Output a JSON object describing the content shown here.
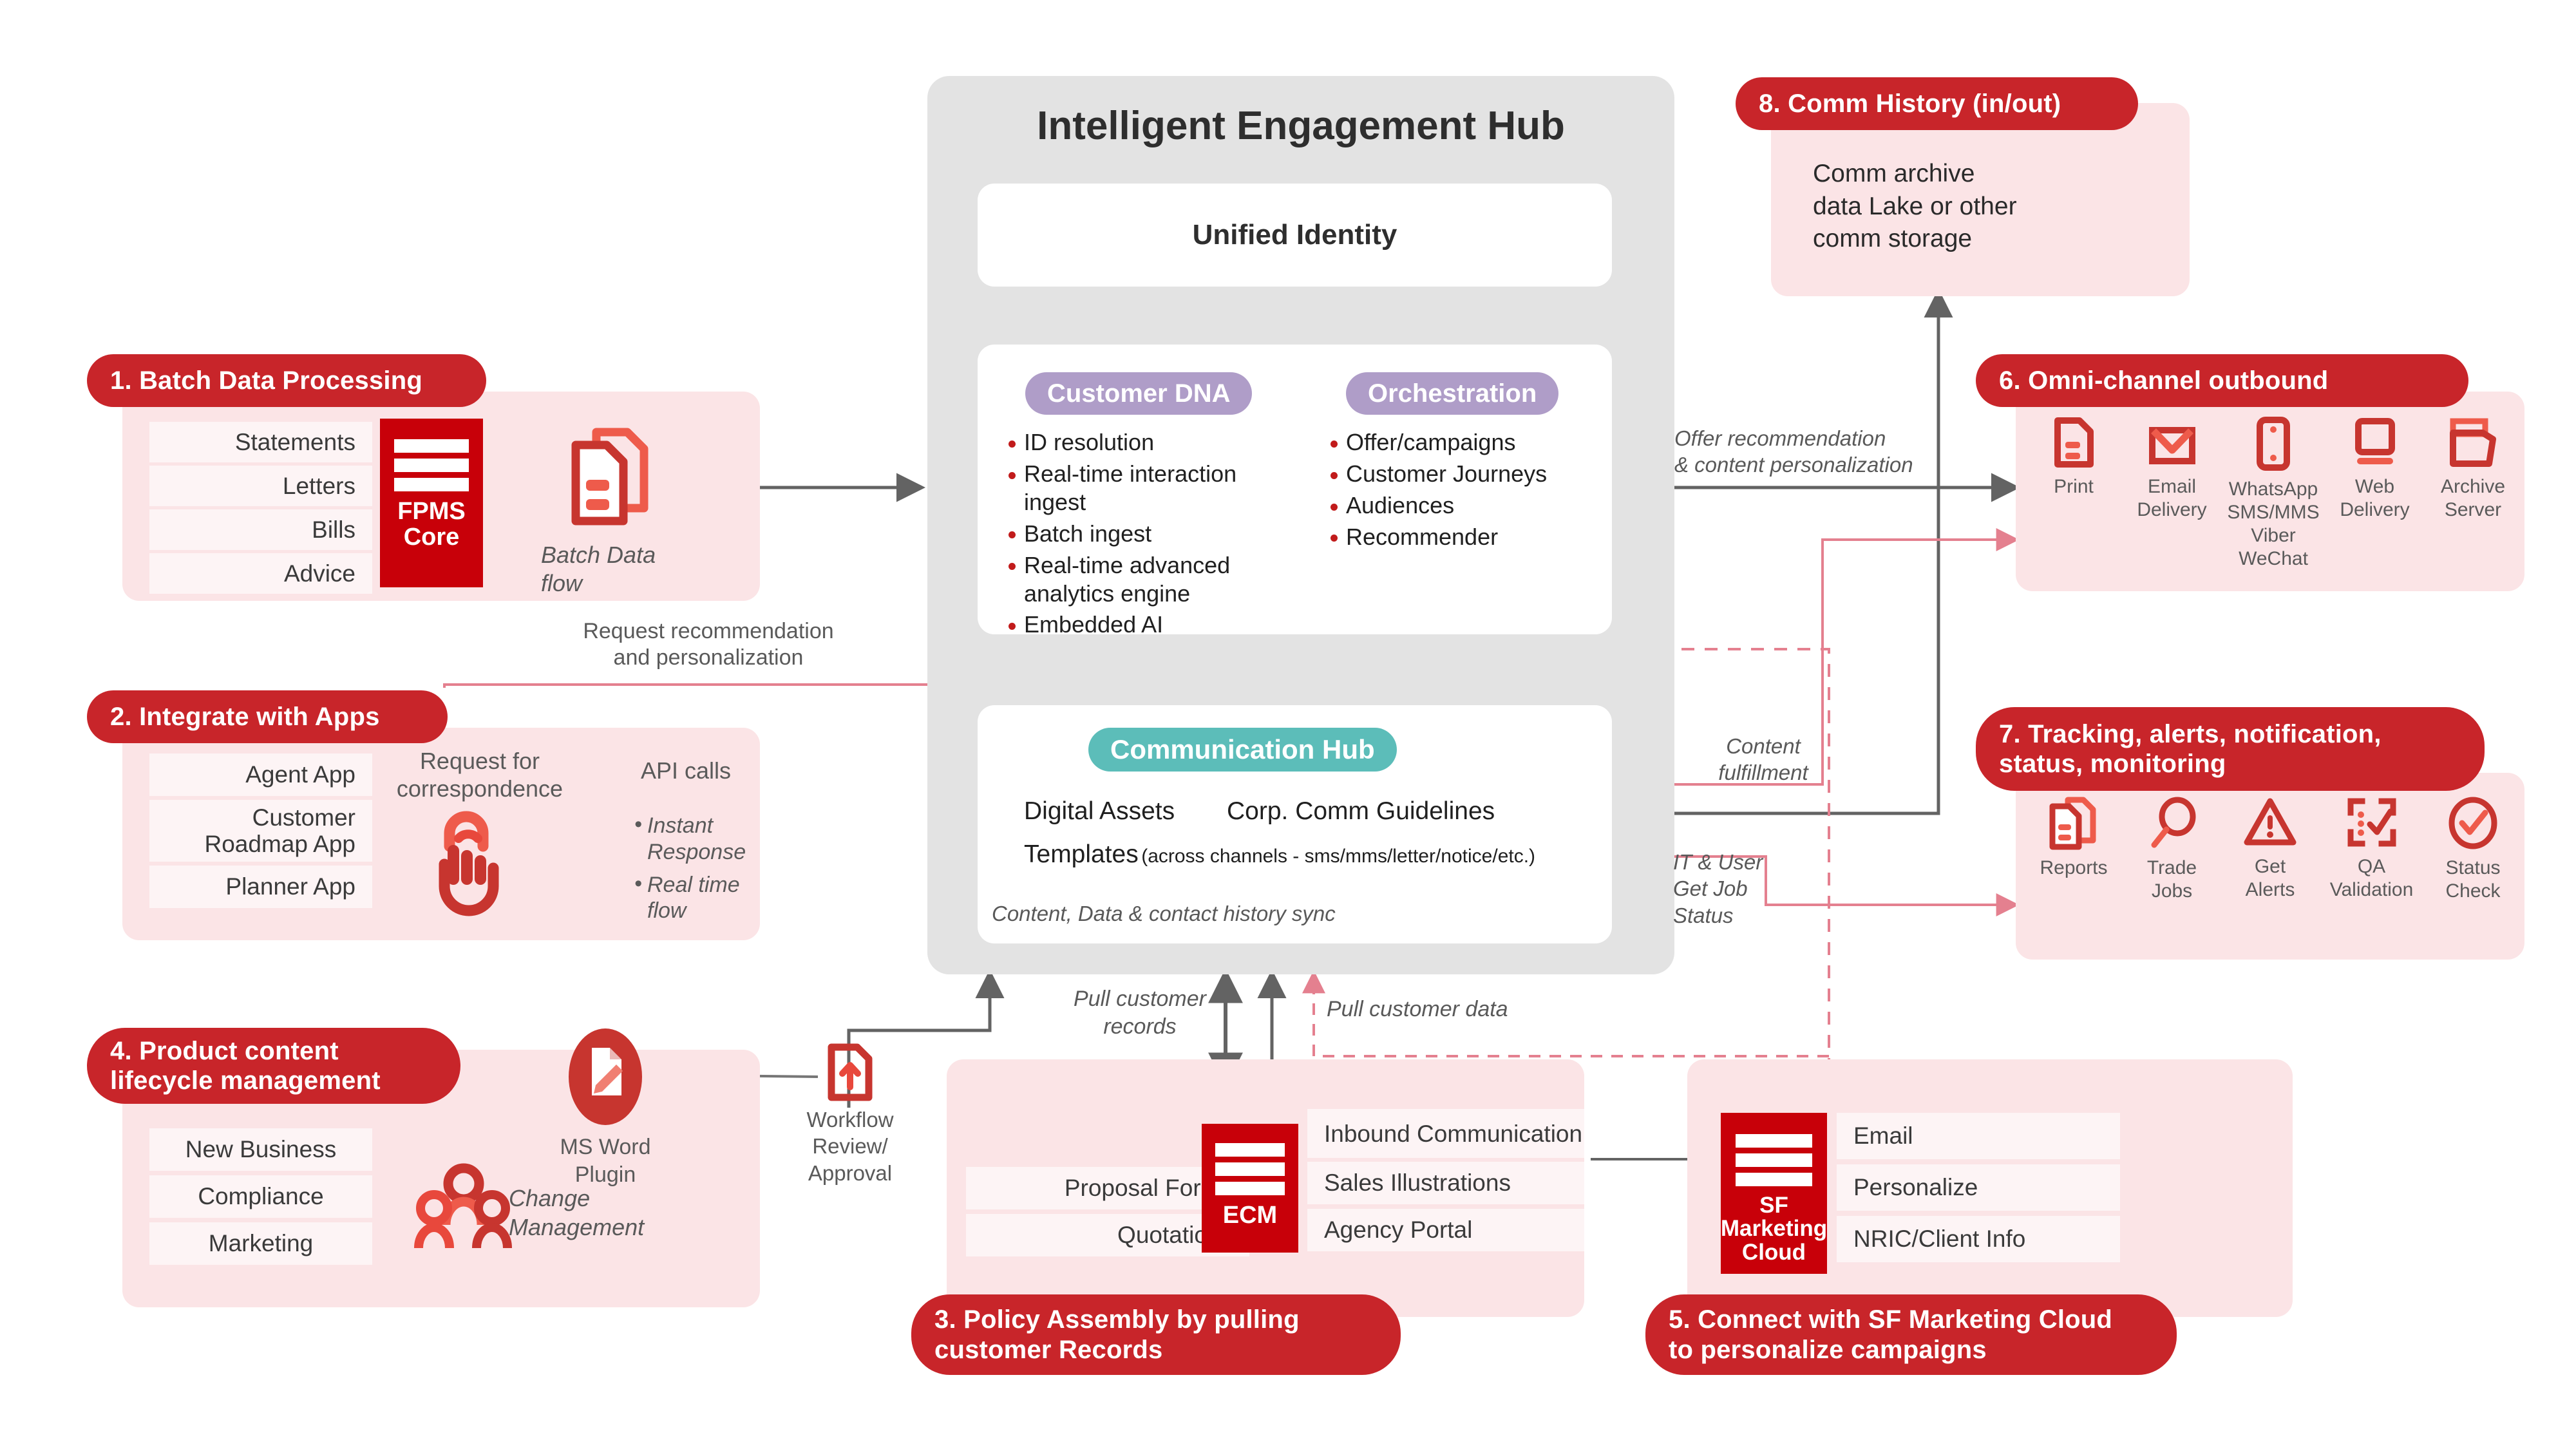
{
  "hub": {
    "title": "Intelligent Engagement Hub",
    "unified_identity": "Unified Identity",
    "customer_dna": {
      "label": "Customer DNA",
      "items": [
        "ID resolution",
        "Real-time interaction ingest",
        "Batch ingest",
        "Real-time advanced analytics engine",
        "Embedded AI"
      ]
    },
    "orchestration": {
      "label": "Orchestration",
      "items": [
        "Offer/campaigns",
        "Customer Journeys",
        "Audiences",
        "Recommender"
      ]
    },
    "communication_hub": {
      "label": "Communication Hub",
      "digital_assets": "Digital Assets",
      "corp_guidelines": "Corp. Comm Guidelines",
      "templates_label": "Templates",
      "templates_note": "(across channels - sms/mms/letter/notice/etc.)",
      "footer": "Content, Data & contact history sync"
    }
  },
  "section1": {
    "badge": "1. Batch Data Processing",
    "rows": [
      "Statements",
      "Letters",
      "Bills",
      "Advice"
    ],
    "core": "FPMS Core",
    "core_line1": "FPMS",
    "core_line2": "Core",
    "icon_caption": "Batch Data flow",
    "icon_caption_l1": "Batch Data",
    "icon_caption_l2": "flow"
  },
  "section2": {
    "badge": "2. Integrate with Apps",
    "rows": [
      "Agent App",
      "Customer Roadmap App",
      "Planner App"
    ],
    "request_label_l1": "Request for",
    "request_label_l2": "correspondence",
    "api_calls": "API calls",
    "bullets": [
      "Instant Response",
      "Real time flow"
    ]
  },
  "section3": {
    "badge": "3. Policy Assembly by pulling customer Records",
    "badge_l1": "3. Policy Assembly by pulling",
    "badge_l2": "customer Records",
    "left_rows": [
      "Proposal Forms",
      "Quotations"
    ],
    "right_rows": [
      "Inbound Communication",
      "Sales Illustrations",
      "Agency Portal"
    ],
    "core_line1": "ECM"
  },
  "section4": {
    "badge_l1": "4. Product content",
    "badge_l2": "lifecycle management",
    "rows": [
      "New Business",
      "Compliance",
      "Marketing"
    ],
    "ms_word_l1": "MS Word",
    "ms_word_l2": "Plugin",
    "change_l1": "Change",
    "change_l2": "Management"
  },
  "section5": {
    "badge_l1": "5. Connect with SF Marketing Cloud",
    "badge_l2": "to personalize campaigns",
    "core_l1": "SF",
    "core_l2": "Marketing",
    "core_l3": "Cloud",
    "rows": [
      "Email",
      "Personalize",
      "NRIC/Client Info"
    ]
  },
  "section6": {
    "badge": "6. Omni-channel outbound",
    "channels": [
      {
        "icon": "document-icon",
        "l1": "Print",
        "l2": "",
        "l3": "",
        "l4": ""
      },
      {
        "icon": "envelope-icon",
        "l1": "Email",
        "l2": "Delivery",
        "l3": "",
        "l4": ""
      },
      {
        "icon": "mobile-icon",
        "l1": "WhatsApp",
        "l2": "SMS/MMS",
        "l3": "Viber",
        "l4": "WeChat"
      },
      {
        "icon": "monitor-icon",
        "l1": "Web",
        "l2": "Delivery",
        "l3": "",
        "l4": ""
      },
      {
        "icon": "folder-icon",
        "l1": "Archive",
        "l2": "Server",
        "l3": "",
        "l4": ""
      }
    ]
  },
  "section7": {
    "badge_l1": "7. Tracking, alerts, notification,",
    "badge_l2": "status, monitoring",
    "items": [
      {
        "icon": "reports-icon",
        "l1": "Reports",
        "l2": ""
      },
      {
        "icon": "magnifier-icon",
        "l1": "Trade",
        "l2": "Jobs"
      },
      {
        "icon": "warning-icon",
        "l1": "Get",
        "l2": "Alerts"
      },
      {
        "icon": "checklist-icon",
        "l1": "QA",
        "l2": "Validation"
      },
      {
        "icon": "check-circle-icon",
        "l1": "Status",
        "l2": "Check"
      }
    ]
  },
  "section8": {
    "badge": "8. Comm History (in/out)",
    "body_l1": "Comm archive",
    "body_l2": "data Lake or other",
    "body_l3": "comm storage"
  },
  "connectors": {
    "request_rec_l1": "Request recommendation",
    "request_rec_l2": "and personalization",
    "offer_rec_l1": "Offer recommendation",
    "offer_rec_l2": "& content personalization",
    "content_fulfillment_l1": "Content",
    "content_fulfillment_l2": "fulfillment",
    "it_user_l1": "IT & User",
    "it_user_l2": "Get Job",
    "it_user_l3": "Status",
    "pull_records_l1": "Pull customer",
    "pull_records_l2": "records",
    "pull_data": "Pull customer data",
    "workflow_l1": "Workflow",
    "workflow_l2": "Review/",
    "workflow_l3": "Approval"
  },
  "colors": {
    "brand_red": "#C8252A",
    "core_red": "#C80009",
    "panel_pink": "#FBE4E6",
    "row_pink": "#FDF4F5",
    "hub_grey": "#E3E3E3",
    "purple": "#AF9DC8",
    "teal": "#5CBDB9",
    "arrow_grey": "#636363",
    "arrow_pink": "#E4808F"
  }
}
